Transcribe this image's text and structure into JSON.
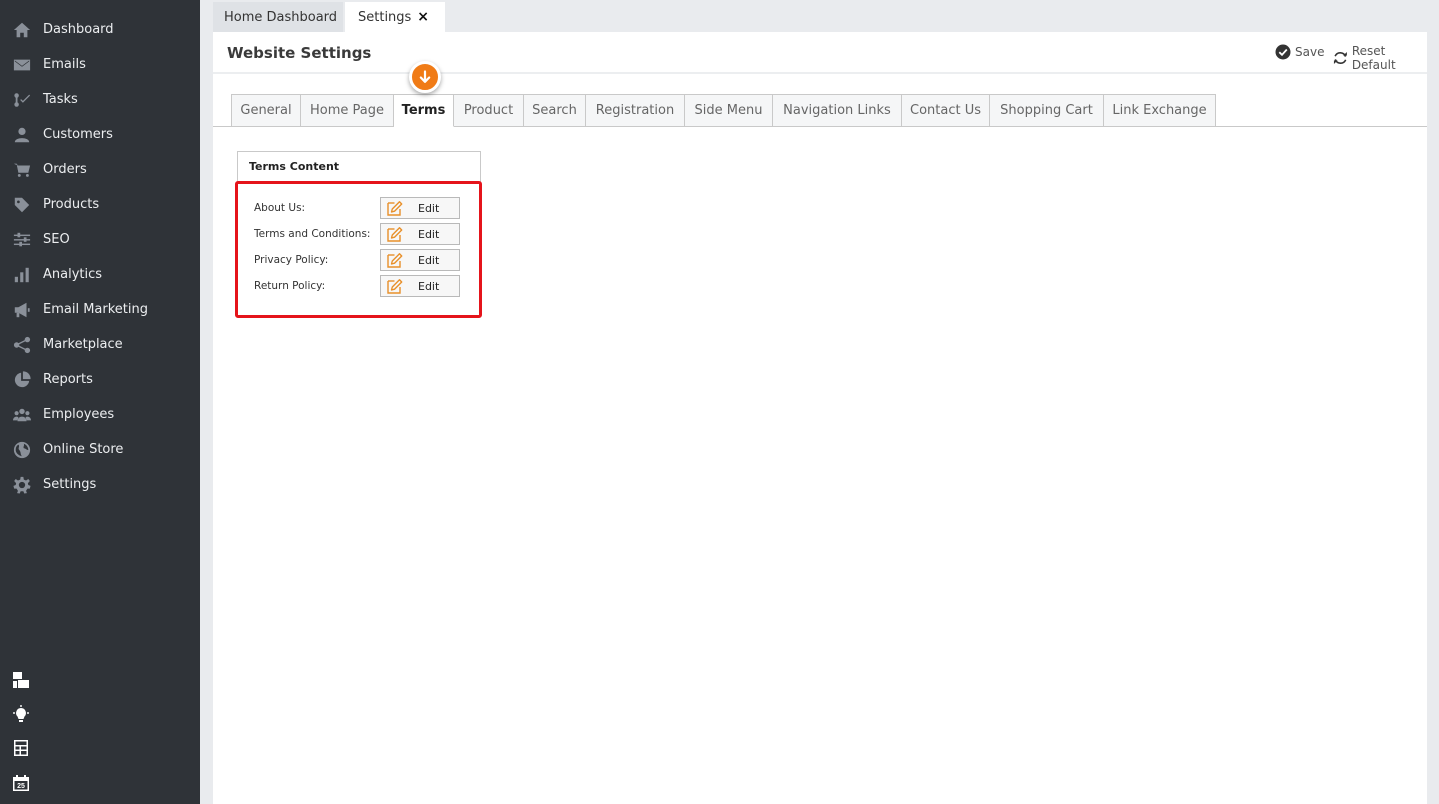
{
  "sidebar": {
    "items": [
      {
        "label": "Dashboard",
        "icon": "home-icon"
      },
      {
        "label": "Emails",
        "icon": "envelope-icon"
      },
      {
        "label": "Tasks",
        "icon": "tasks-icon"
      },
      {
        "label": "Customers",
        "icon": "user-icon"
      },
      {
        "label": "Orders",
        "icon": "cart-icon"
      },
      {
        "label": "Products",
        "icon": "tag-icon"
      },
      {
        "label": "SEO",
        "icon": "sliders-icon"
      },
      {
        "label": "Analytics",
        "icon": "bar-chart-icon"
      },
      {
        "label": "Email Marketing",
        "icon": "megaphone-icon"
      },
      {
        "label": "Marketplace",
        "icon": "share-icon"
      },
      {
        "label": "Reports",
        "icon": "pie-chart-icon"
      },
      {
        "label": "Employees",
        "icon": "users-icon"
      },
      {
        "label": "Online Store",
        "icon": "globe-icon"
      },
      {
        "label": "Settings",
        "icon": "gear-icon"
      }
    ],
    "bottom_icons": [
      "windows-icon",
      "lightbulb-icon",
      "calculator-icon",
      "calendar-icon"
    ],
    "calendar_day": "25"
  },
  "top_tabs": {
    "home": "Home Dashboard",
    "settings": "Settings",
    "close": "×"
  },
  "panel": {
    "title": "Website Settings",
    "save": "Save",
    "reset": "Reset Default"
  },
  "settings_tabs": [
    "General",
    "Home Page",
    "Terms",
    "Product",
    "Search",
    "Registration",
    "Side Menu",
    "Navigation Links",
    "Contact Us",
    "Shopping Cart",
    "Link Exchange"
  ],
  "active_tab": "Terms",
  "terms": {
    "title": "Terms Content",
    "rows": [
      {
        "label": "About Us:",
        "button": "Edit"
      },
      {
        "label": "Terms and Conditions:",
        "button": "Edit"
      },
      {
        "label": "Privacy Policy:",
        "button": "Edit"
      },
      {
        "label": "Return Policy:",
        "button": "Edit"
      }
    ]
  },
  "colors": {
    "sidebar_bg": "#2f3338",
    "accent_orange": "#f07b16",
    "highlight_red": "#e5141b"
  }
}
